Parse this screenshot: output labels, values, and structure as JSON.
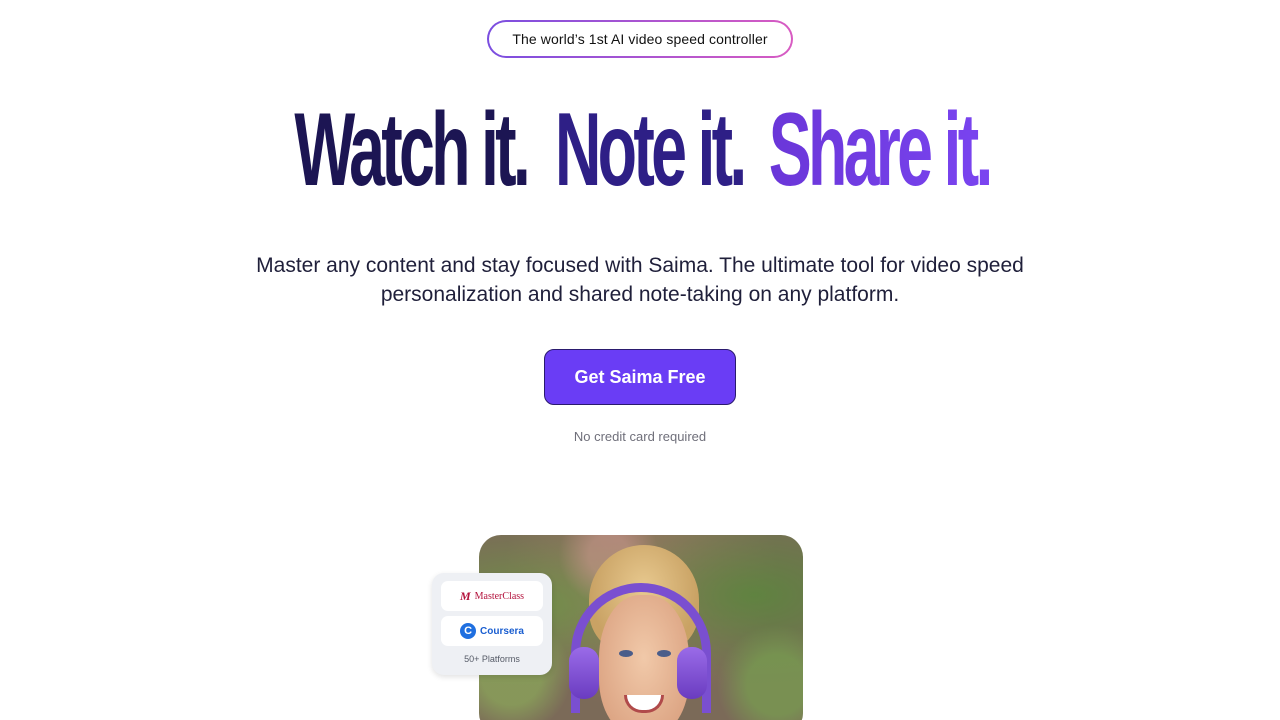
{
  "badge": {
    "text": "The world’s 1st AI video speed controller"
  },
  "hero": {
    "headline_part1": "Watch it.",
    "headline_part2": "Note it.",
    "headline_part3": "Share it.",
    "subtitle": "Master any content and stay focused with Saima. The ultimate tool for video speed personalization and shared note-taking on any platform.",
    "cta_label": "Get Saima Free",
    "note": "No credit card required"
  },
  "platforms": {
    "items": [
      {
        "name": "MasterClass",
        "icon": "masterclass-logo"
      },
      {
        "name": "Coursera",
        "icon": "coursera-logo"
      }
    ],
    "count_label": "50+ Platforms"
  },
  "colors": {
    "accent": "#6a3df5",
    "headline_dark": "#1c1553",
    "headline_mid": "#2e1f86",
    "headline_light": "#7a44f0"
  }
}
